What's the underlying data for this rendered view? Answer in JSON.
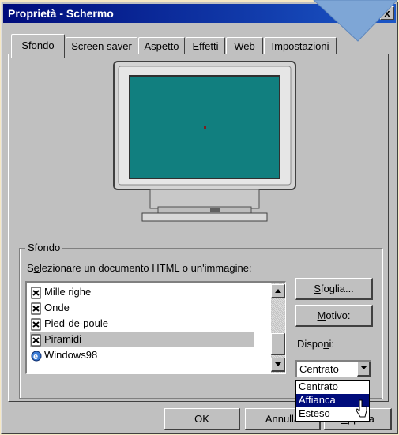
{
  "window": {
    "title": "Proprietà - Schermo",
    "help_label": "?",
    "close_label": "x"
  },
  "tabs": [
    {
      "label": "Sfondo",
      "active": true
    },
    {
      "label": "Screen saver",
      "active": false
    },
    {
      "label": "Aspetto",
      "active": false
    },
    {
      "label": "Effetti",
      "active": false
    },
    {
      "label": "Web",
      "active": false
    },
    {
      "label": "Impostazioni",
      "active": false
    }
  ],
  "monitor": {
    "screen_color": "#117f7f"
  },
  "background_group": {
    "legend": "Sfondo",
    "prompt_pre": "S",
    "prompt_ul": "e",
    "prompt_post": "lezionare un documento HTML o un'immagine:",
    "list_items": [
      {
        "label": "Mille righe",
        "selected": false
      },
      {
        "label": "Onde",
        "selected": false
      },
      {
        "label": "Pied-de-poule",
        "selected": false
      },
      {
        "label": "Piramidi",
        "selected": true
      },
      {
        "label": "Windows98",
        "selected": false
      }
    ],
    "browse_ul": "S",
    "browse_rest": "foglia...",
    "pattern_ul": "M",
    "pattern_rest": "otivo:",
    "display_pre": "Dispo",
    "display_ul": "n",
    "display_post": "i:",
    "display_selected": "Centrato",
    "display_options": [
      {
        "label": "Centrato",
        "highlighted": false
      },
      {
        "label": "Affianca",
        "highlighted": true
      },
      {
        "label": "Esteso",
        "highlighted": false
      }
    ]
  },
  "footer": {
    "ok_label": "OK",
    "cancel_label": "Annulla",
    "apply_ul": "A",
    "apply_rest": "pplica"
  },
  "colors": {
    "titlebar_start": "#000c7b",
    "titlebar_end": "#1b56c6",
    "page_background": "#f6e8c4",
    "arrow": "#7ea6d6"
  }
}
